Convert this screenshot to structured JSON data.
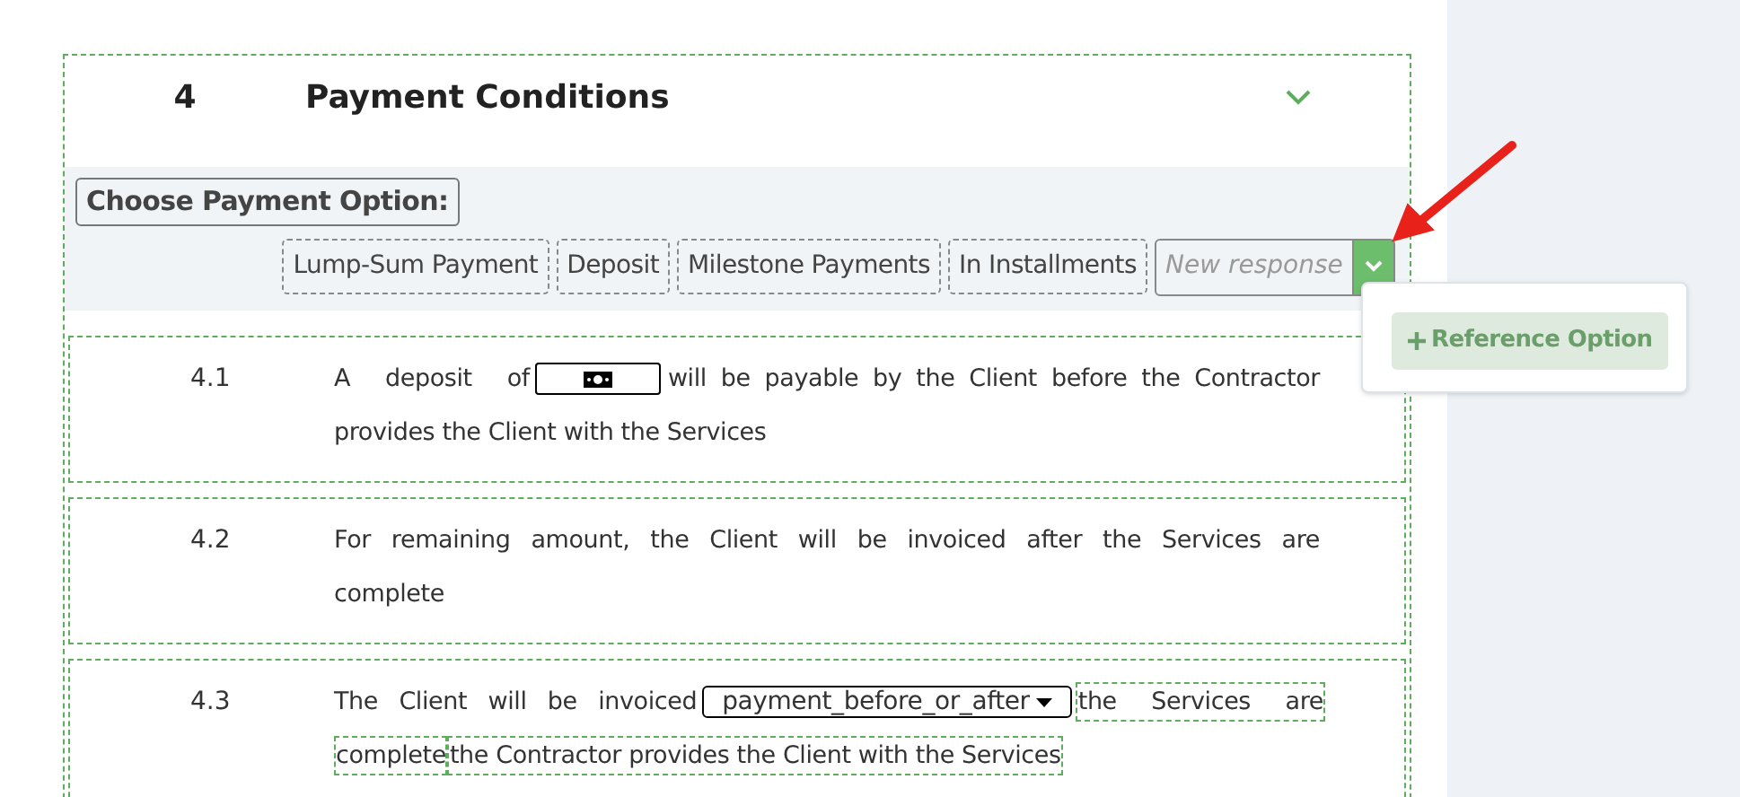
{
  "section": {
    "number": "4",
    "title": "Payment Conditions",
    "expanded": true
  },
  "option_picker": {
    "label": "Choose Payment Option:",
    "options": [
      {
        "label": "Lump-Sum Payment",
        "selected": false
      },
      {
        "label": "Deposit",
        "selected": false
      },
      {
        "label": "Milestone Payments",
        "selected": false
      },
      {
        "label": "In Installments",
        "selected": false
      }
    ],
    "new_response": {
      "placeholder": "New response"
    },
    "menu": {
      "open": true,
      "items": [
        "Reference Option"
      ]
    }
  },
  "clauses": [
    {
      "number": "4.1",
      "lines": [
        [
          {
            "kind": "text",
            "text": "A deposit of"
          },
          {
            "kind": "amount"
          },
          {
            "kind": "text",
            "text": "will be payable by the Client before the Contractor"
          }
        ],
        [
          {
            "kind": "text",
            "text": "provides the Client with the Services"
          }
        ]
      ]
    },
    {
      "number": "4.2",
      "lines": [
        [
          {
            "kind": "text",
            "text": "For remaining amount, the Client will be invoiced after the Services are"
          }
        ],
        [
          {
            "kind": "text",
            "text": "complete"
          }
        ]
      ]
    },
    {
      "number": "4.3",
      "lines": [
        [
          {
            "kind": "text",
            "text": "The Client will be invoiced"
          },
          {
            "kind": "select",
            "value": "payment_before_or_after"
          },
          {
            "kind": "option",
            "text": "the Services are"
          }
        ],
        [
          {
            "kind": "option",
            "text": "complete"
          },
          {
            "kind": "option",
            "text": "the Contractor provides the Client with the Services"
          }
        ]
      ]
    }
  ]
}
